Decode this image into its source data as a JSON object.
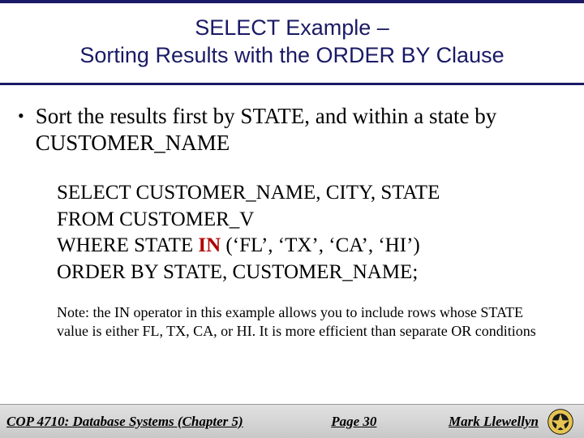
{
  "title": {
    "line1": "SELECT Example –",
    "line2": "Sorting Results with the ORDER BY Clause"
  },
  "bullet": {
    "marker": "•",
    "text": "Sort the results first by STATE, and within a state by CUSTOMER_NAME"
  },
  "sql": {
    "line1": "SELECT CUSTOMER_NAME, CITY, STATE",
    "line2": "FROM CUSTOMER_V",
    "line3_prefix": "WHERE STATE ",
    "line3_kw": "IN",
    "line3_suffix": " (‘FL’, ‘TX’, ‘CA’, ‘HI’)",
    "line4": "ORDER BY STATE, CUSTOMER_NAME;"
  },
  "note": "Note: the IN operator in this example allows you to include rows whose STATE value is either FL, TX, CA, or HI. It is more efficient than separate OR conditions",
  "footer": {
    "left": "COP 4710: Database Systems  (Chapter 5)",
    "center": "Page 30",
    "right": "Mark Llewellyn"
  }
}
